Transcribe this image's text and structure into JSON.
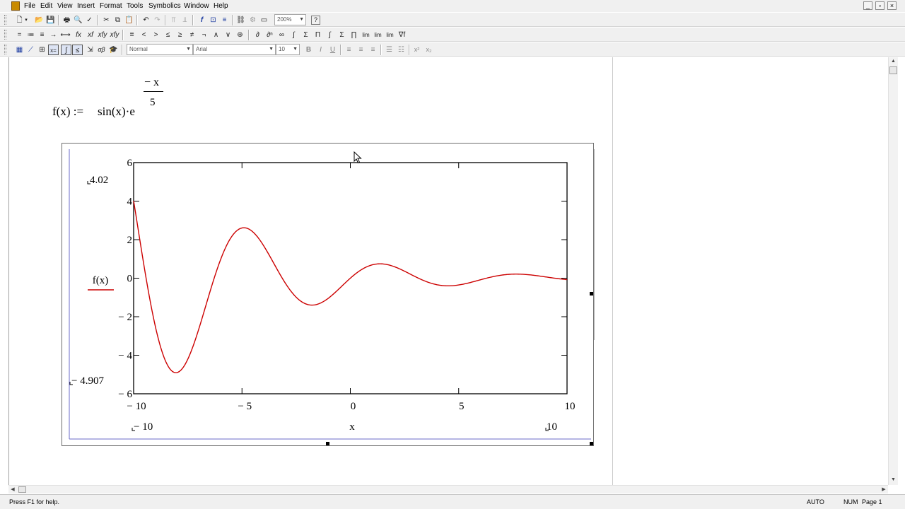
{
  "menu": [
    "File",
    "Edit",
    "View",
    "Insert",
    "Format",
    "Tools",
    "Symbolics",
    "Window",
    "Help"
  ],
  "window_controls": [
    "minimize-icon",
    "restore-icon",
    "close-icon"
  ],
  "toolbar_standard": {
    "zoom": "200%",
    "help_icon": "?"
  },
  "toolbar_math": {
    "symbols": [
      "=",
      "≔",
      "≡",
      "→",
      "⟷",
      "fx",
      "xf",
      "xfy",
      "xfy",
      "=",
      "<",
      ">",
      "≤",
      "≥",
      "≠",
      "¬",
      "∧",
      "∨",
      "⊕"
    ]
  },
  "toolbar_format": {
    "style": "Normal",
    "font": "Arial",
    "size": "10",
    "bold": "B",
    "italic": "I",
    "underline": "U",
    "superscript": "x²",
    "subscript": "x₂"
  },
  "equation": {
    "lhs": "f(x) :=",
    "rhs": "sin(x)·e",
    "exp_numerator": "− x",
    "exp_denominator": "5"
  },
  "chart_data": {
    "type": "line",
    "function": "f(x) = sin(x)·e^(−x/5)",
    "x_label": "x",
    "y_label": "f(x)",
    "xlim": [
      -10,
      10
    ],
    "ylim": [
      -6,
      6
    ],
    "x_ticks": [
      "− 10",
      "− 5",
      "0",
      "5",
      "10"
    ],
    "y_ticks": [
      "6",
      "4",
      "2",
      "0",
      "− 2",
      "− 4",
      "− 6"
    ],
    "x_range_labels": {
      "min": "− 10",
      "max": "10"
    },
    "y_range_labels": {
      "max": "4.02",
      "min": "− 4.907"
    },
    "series": [
      {
        "color": "#cc0000",
        "samples": 401
      }
    ]
  },
  "status": {
    "help": "Press F1 for help.",
    "mode": "AUTO",
    "num": "NUM",
    "page": "Page 1"
  }
}
